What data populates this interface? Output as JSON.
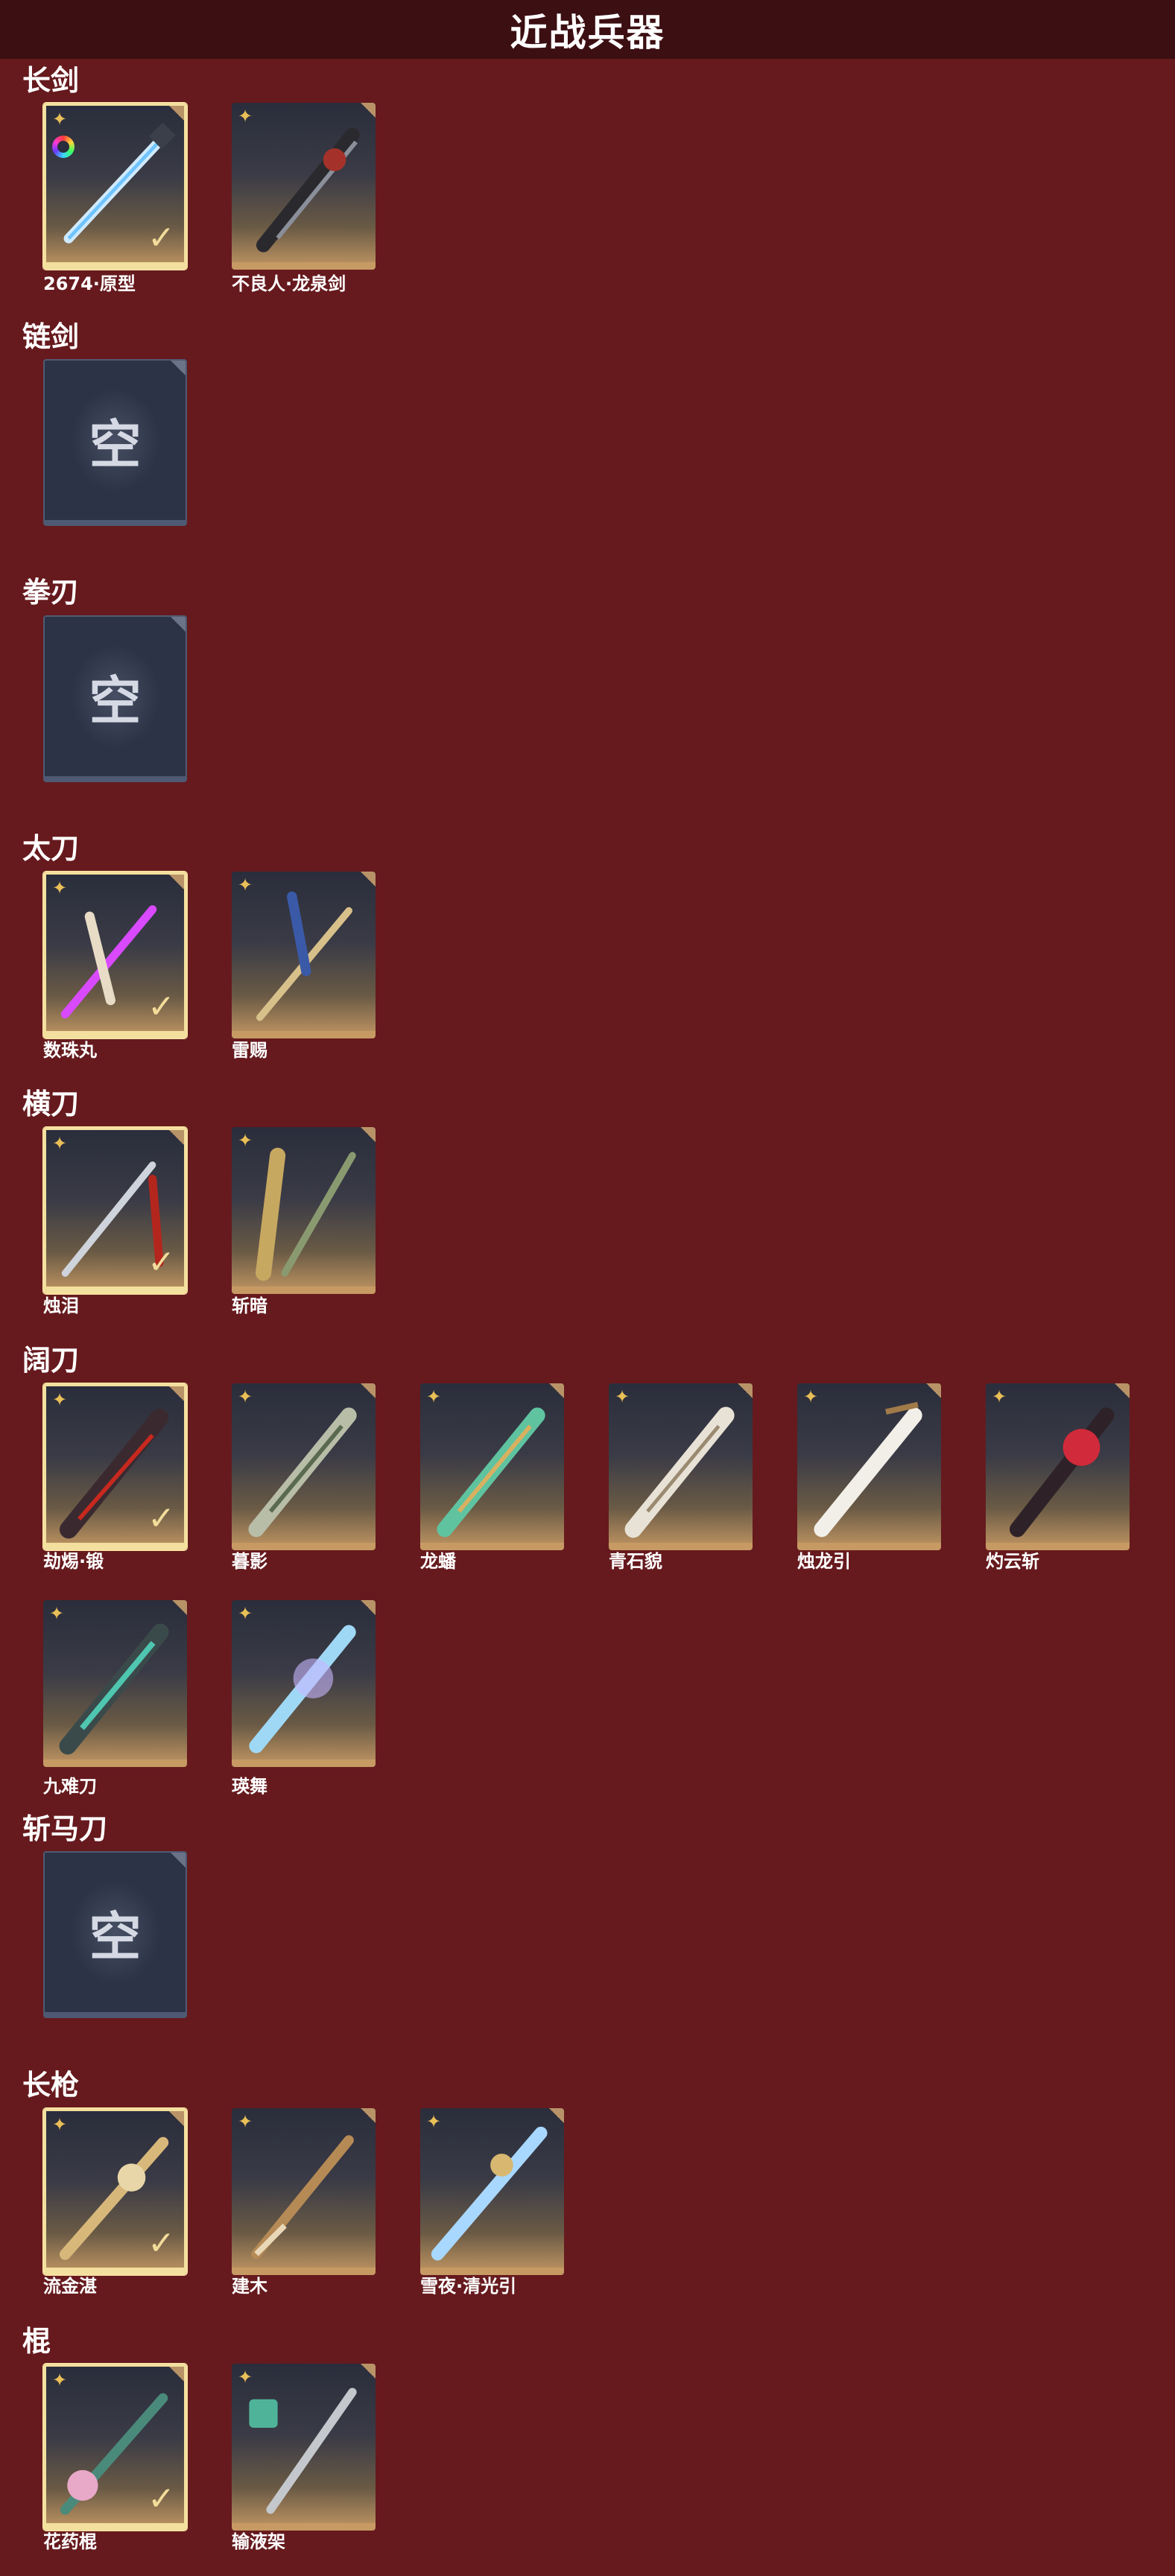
{
  "header": {
    "title": "近战兵器"
  },
  "sections": [
    {
      "title": "长剑",
      "items": [
        {
          "name": "2674·原型",
          "selected": true,
          "ring": true
        },
        {
          "name": "不良人·龙泉剑",
          "selected": false
        }
      ]
    },
    {
      "title": "链剑",
      "empty": "空"
    },
    {
      "title": "拳刃",
      "empty": "空"
    },
    {
      "title": "太刀",
      "items": [
        {
          "name": "数珠丸",
          "selected": true
        },
        {
          "name": "雷赐",
          "selected": false
        }
      ]
    },
    {
      "title": "横刀",
      "items": [
        {
          "name": "烛泪",
          "selected": true
        },
        {
          "name": "斩暗",
          "selected": false
        }
      ]
    },
    {
      "title": "阔刀",
      "items": [
        {
          "name": "劫焬·锻",
          "selected": true
        },
        {
          "name": "暮影",
          "selected": false
        },
        {
          "name": "龙蟠",
          "selected": false
        },
        {
          "name": "青石貌",
          "selected": false
        },
        {
          "name": "烛龙引",
          "selected": false
        },
        {
          "name": "灼云斩",
          "selected": false
        },
        {
          "name": "九难刀",
          "selected": false
        },
        {
          "name": "瑛舞",
          "selected": false
        }
      ]
    },
    {
      "title": "斩马刀",
      "empty": "空"
    },
    {
      "title": "长枪",
      "items": [
        {
          "name": "流金湛",
          "selected": true
        },
        {
          "name": "建木",
          "selected": false
        },
        {
          "name": "雪夜·清光引",
          "selected": false
        }
      ]
    },
    {
      "title": "棍",
      "items": [
        {
          "name": "花药棍",
          "selected": true
        },
        {
          "name": "输液架",
          "selected": false
        }
      ]
    }
  ],
  "icons": {
    "star": "star-icon",
    "check": "check-icon",
    "corner": "corner-tag-icon"
  },
  "colors": {
    "background": "#661a1e",
    "header": "#3c0f12",
    "selected_border": "#f3df9e",
    "card_bottom": "#c79a64"
  }
}
